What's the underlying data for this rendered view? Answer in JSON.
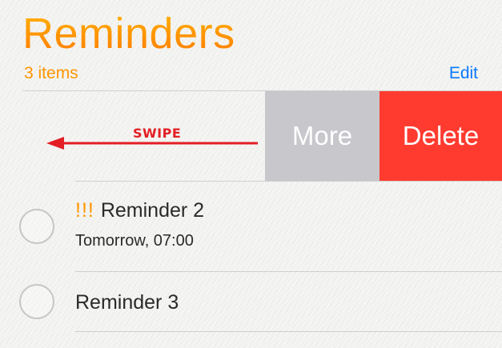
{
  "header": {
    "title": "Reminders",
    "count": "3 items",
    "edit_label": "Edit"
  },
  "swipe_hint": {
    "label": "SWIPE",
    "color": "#e31e24"
  },
  "swipe_actions": {
    "more_label": "More",
    "delete_label": "Delete",
    "more_color": "#c7c7cc",
    "delete_color": "#ff3b30"
  },
  "reminders": [
    {
      "priority": "!!!",
      "title": "Reminder 2",
      "due": "Tomorrow, 07:00"
    },
    {
      "title": "Reminder 3"
    }
  ],
  "colors": {
    "accent_orange": "#ff9500",
    "link_blue": "#0a7aff"
  }
}
